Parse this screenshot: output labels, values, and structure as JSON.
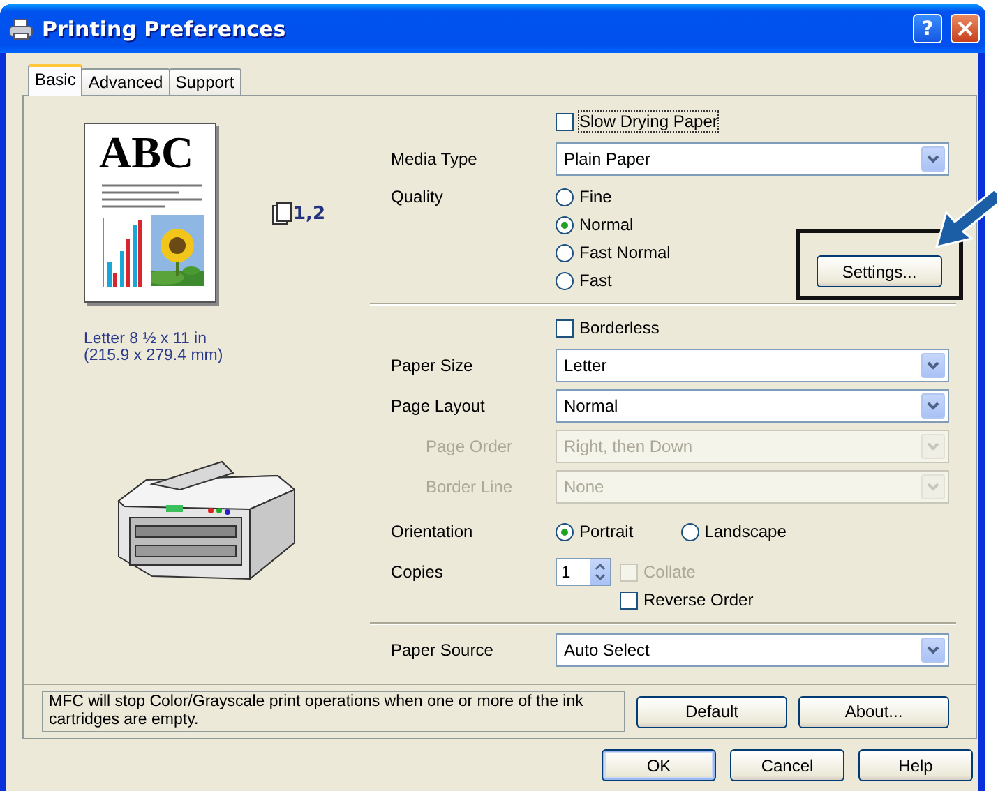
{
  "window": {
    "title": "Printing Preferences",
    "help_button": "?"
  },
  "tabs": [
    {
      "label": "Basic",
      "selected": true
    },
    {
      "label": "Advanced",
      "selected": false
    },
    {
      "label": "Support",
      "selected": false
    }
  ],
  "preview": {
    "heading": "ABC",
    "page_order": "1,2",
    "paper_size": [
      "Letter 8 ½ x 11 in",
      "(215.9 x 279.4 mm)"
    ]
  },
  "settings": [
    {
      "kind": "checkbox",
      "label": "Slow Drying Paper",
      "checked": false,
      "disabled": false,
      "focused": true
    },
    {
      "kind": "select",
      "label": "Media Type",
      "value": "Plain Paper",
      "disabled": false
    },
    {
      "kind": "radio_column",
      "label": "Quality",
      "options": [
        {
          "label": "Fine",
          "selected": false
        },
        {
          "label": "Normal",
          "selected": true
        },
        {
          "label": "Fast Normal",
          "selected": false
        },
        {
          "label": "Fast",
          "selected": false
        }
      ],
      "button": {
        "label": "Settings...",
        "highlighted": true
      }
    },
    {
      "kind": "divider"
    },
    {
      "kind": "checkbox",
      "label": "Borderless",
      "checked": false,
      "disabled": false,
      "focused": false
    },
    {
      "kind": "select",
      "label": "Paper Size",
      "value": "Letter",
      "disabled": false
    },
    {
      "kind": "select",
      "label": "Page Layout",
      "value": "Normal",
      "disabled": false
    },
    {
      "kind": "select",
      "label": "Page Order",
      "value": "Right, then Down",
      "disabled": true
    },
    {
      "kind": "select",
      "label": "Border Line",
      "value": "None",
      "disabled": true
    },
    {
      "kind": "radio_row",
      "label": "Orientation",
      "options": [
        {
          "label": "Portrait",
          "selected": true
        },
        {
          "label": "Landscape",
          "selected": false
        }
      ]
    },
    {
      "kind": "copies",
      "label": "Copies",
      "value": "1",
      "options": [
        {
          "label": "Collate",
          "checked": false,
          "disabled": true
        },
        {
          "label": "Reverse Order",
          "checked": false,
          "disabled": false
        }
      ]
    },
    {
      "kind": "divider"
    },
    {
      "kind": "select",
      "label": "Paper Source",
      "value": "Auto Select",
      "disabled": false
    }
  ],
  "message": "MFC will stop Color/Grayscale print operations when one or more of the ink cartridges are empty.",
  "panel_buttons": [
    "Default",
    "About..."
  ],
  "dialog_buttons": [
    {
      "label": "OK",
      "default": true
    },
    {
      "label": "Cancel",
      "default": false
    },
    {
      "label": "Help",
      "default": false
    }
  ]
}
